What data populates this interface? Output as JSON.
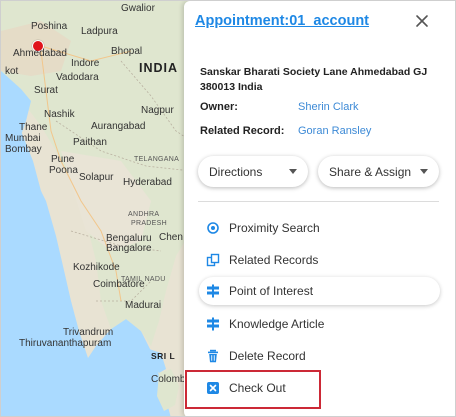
{
  "map": {
    "country_label": "INDIA",
    "cities": [
      {
        "name": "Gwalior"
      },
      {
        "name": "Poshina"
      },
      {
        "name": "Ladpura"
      },
      {
        "name": "Ahmedabad"
      },
      {
        "name": "Bhopal"
      },
      {
        "name": "Indore"
      },
      {
        "name": "Vadodara"
      },
      {
        "name": "kot"
      },
      {
        "name": "Surat"
      },
      {
        "name": "Nashik"
      },
      {
        "name": "Nagpur"
      },
      {
        "name": "Thane"
      },
      {
        "name": "Aurangabad"
      },
      {
        "name": "Mumbai"
      },
      {
        "name": "Bombay"
      },
      {
        "name": "Paithan"
      },
      {
        "name": "Pune"
      },
      {
        "name": "Poona"
      },
      {
        "name": "Solapur"
      },
      {
        "name": "Hyderabad"
      },
      {
        "name": "Bengaluru"
      },
      {
        "name": "Bangalore"
      },
      {
        "name": "Chen"
      },
      {
        "name": "Kozhikode"
      },
      {
        "name": "Coimbatore"
      },
      {
        "name": "Madurai"
      },
      {
        "name": "Trivandrum"
      },
      {
        "name": "Thiruvananthapuram"
      },
      {
        "name": "Colomb"
      }
    ],
    "regions": [
      {
        "name": "TELANGANA"
      },
      {
        "name": "ANDHRA"
      },
      {
        "name": "PRADESH"
      },
      {
        "name": "TAMIL NADU"
      },
      {
        "name": "SRI L"
      }
    ]
  },
  "panel": {
    "title": "Appointment:01_account",
    "address": "Sanskar Bharati Society Lane Ahmedabad GJ 380013 India",
    "owner_label": "Owner:",
    "owner_value": "Sherin Clark",
    "related_label": "Related Record:",
    "related_value": "Goran Ransley",
    "directions_label": "Directions",
    "share_label": "Share & Assign",
    "menu": [
      {
        "label": "Proximity Search",
        "icon": "target-icon"
      },
      {
        "label": "Related Records",
        "icon": "linked-records-icon"
      },
      {
        "label": "Point of Interest",
        "icon": "signpost-icon"
      },
      {
        "label": "Knowledge Article",
        "icon": "signpost-icon"
      },
      {
        "label": "Delete Record",
        "icon": "trash-icon"
      },
      {
        "label": "Check Out",
        "icon": "close-box-icon"
      }
    ],
    "colors": {
      "accent": "#1e88e5",
      "link": "#3d8ad6",
      "highlight_border": "#cc2936"
    }
  }
}
